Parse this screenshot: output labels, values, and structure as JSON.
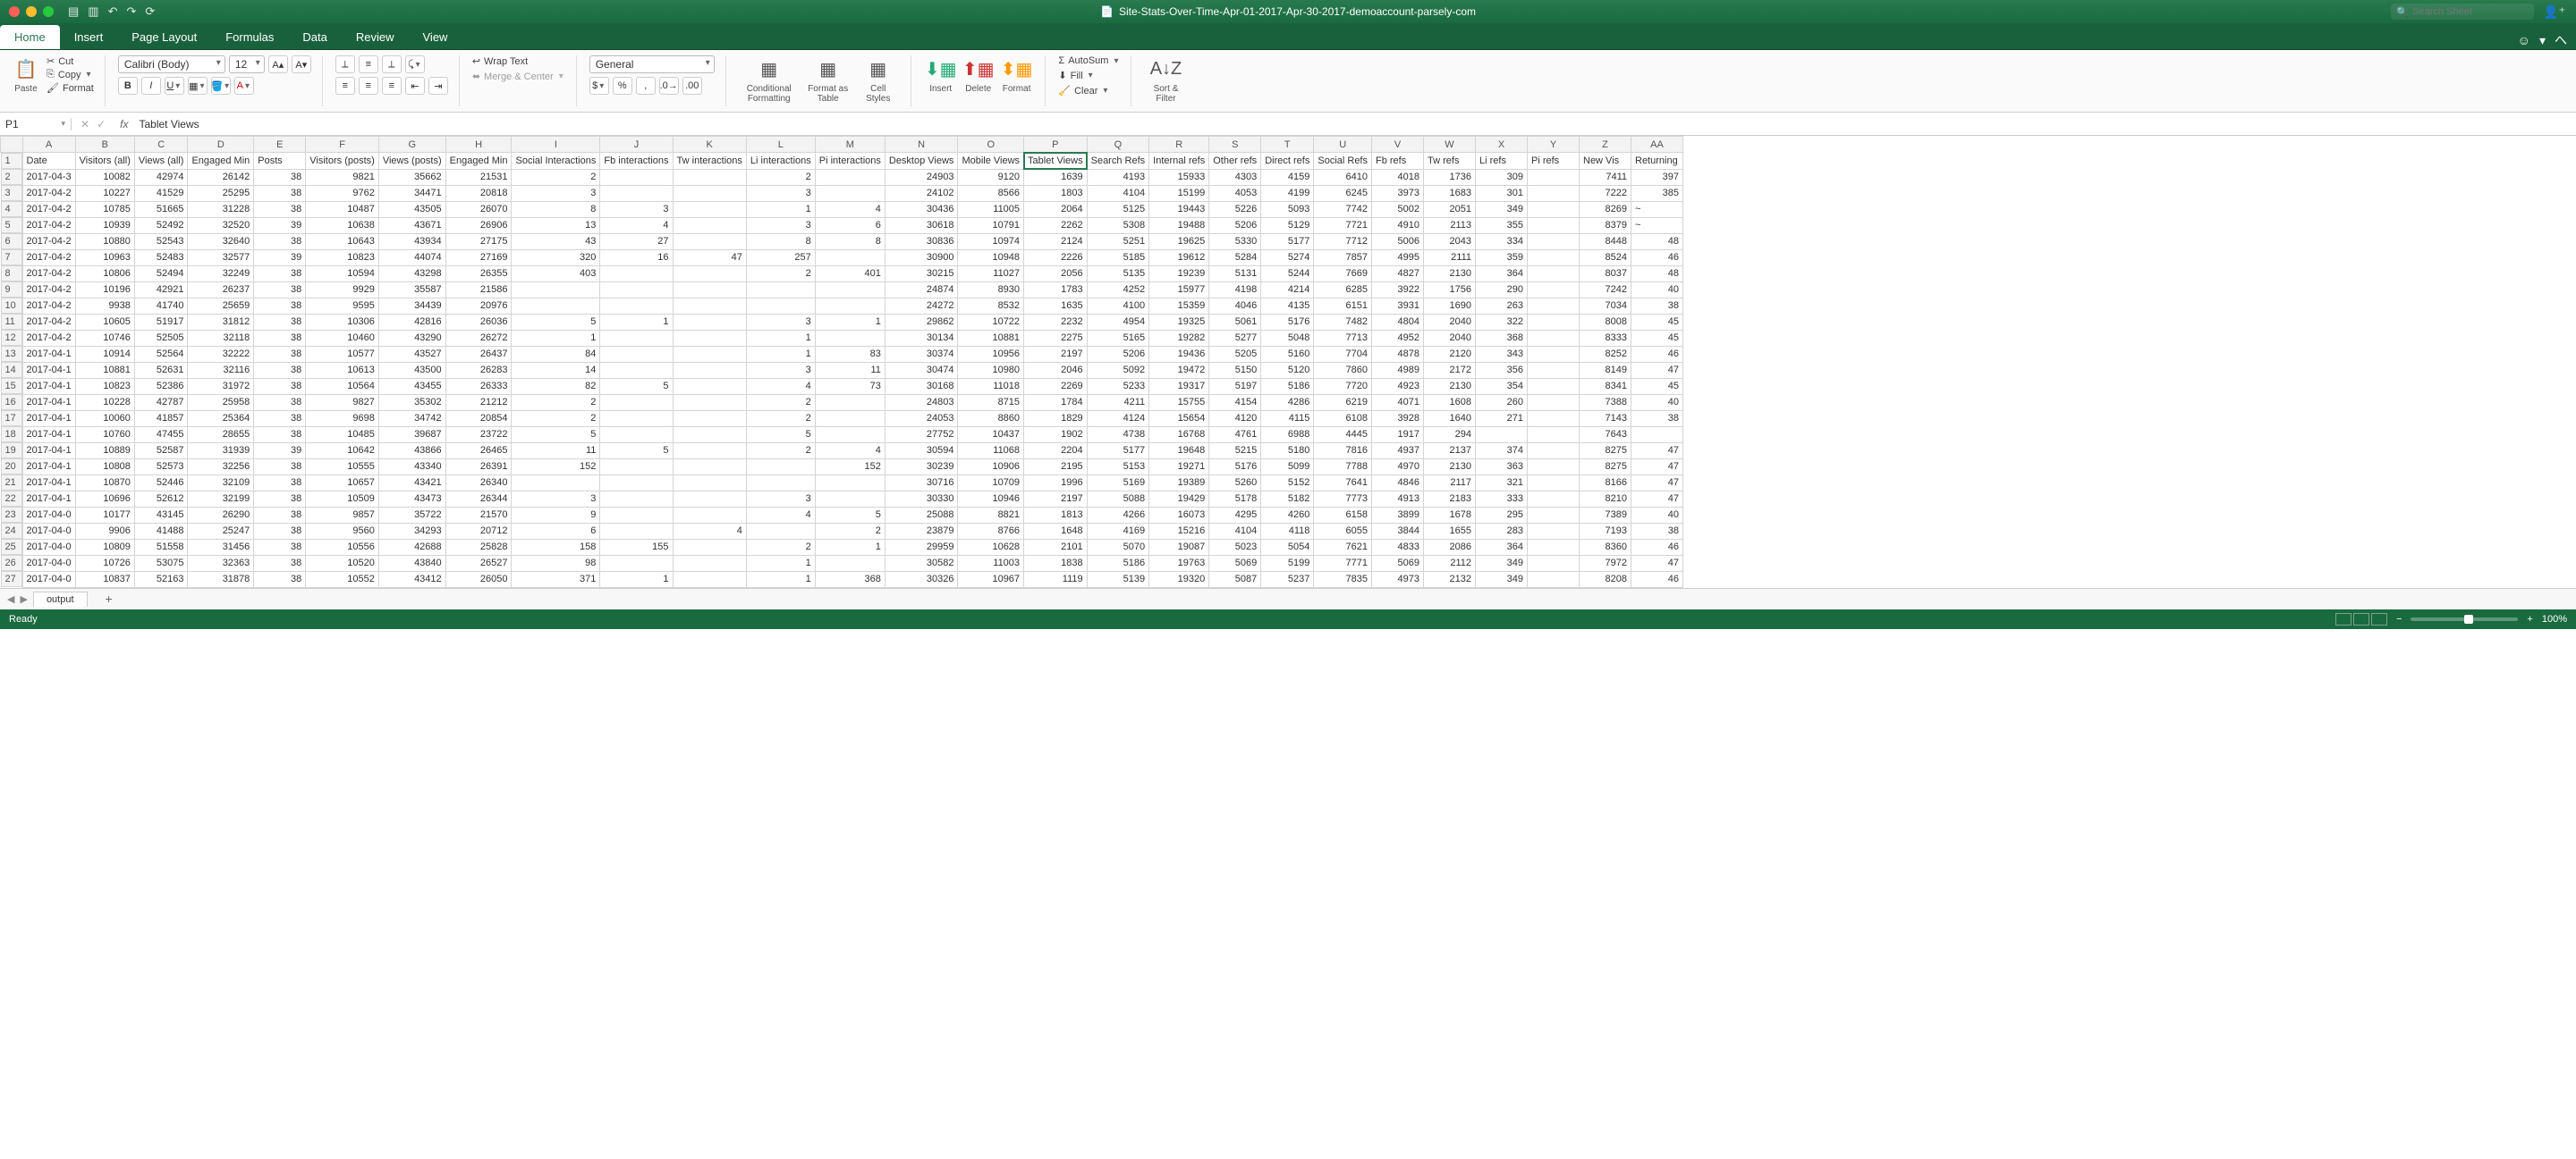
{
  "title": "Site-Stats-Over-Time-Apr-01-2017-Apr-30-2017-demoaccount-parsely-com",
  "search_placeholder": "Search Sheet",
  "tabs": [
    "Home",
    "Insert",
    "Page Layout",
    "Formulas",
    "Data",
    "Review",
    "View"
  ],
  "active_tab": "Home",
  "ribbon": {
    "paste": "Paste",
    "cut": "Cut",
    "copy": "Copy",
    "format": "Format",
    "font_name": "Calibri (Body)",
    "font_size": "12",
    "wrap": "Wrap Text",
    "merge": "Merge & Center",
    "number_format": "General",
    "cond_fmt": "Conditional Formatting",
    "as_table": "Format as Table",
    "cell_styles": "Cell Styles",
    "insert": "Insert",
    "delete": "Delete",
    "format_btn": "Format",
    "autosum": "AutoSum",
    "fill": "Fill",
    "clear": "Clear",
    "sort": "Sort & Filter"
  },
  "name_box": "P1",
  "formula": "Tablet Views",
  "columns": [
    "A",
    "B",
    "C",
    "D",
    "E",
    "F",
    "G",
    "H",
    "I",
    "J",
    "K",
    "L",
    "M",
    "N",
    "O",
    "P",
    "Q",
    "R",
    "S",
    "T",
    "U",
    "V",
    "W",
    "X",
    "Y",
    "Z",
    "AA"
  ],
  "selected_col": "P",
  "headers": [
    "Date",
    "Visitors (all)",
    "Views (all)",
    "Engaged Min",
    "Posts",
    "Visitors (posts)",
    "Views (posts)",
    "Engaged Min",
    "Social Interactions",
    "Fb interactions",
    "Tw interactions",
    "Li interactions",
    "Pi interactions",
    "Desktop Views",
    "Mobile Views",
    "Tablet Views",
    "Search Refs",
    "Internal refs",
    "Other refs",
    "Direct refs",
    "Social Refs",
    "Fb refs",
    "Tw refs",
    "Li refs",
    "Pi refs",
    "New Vis",
    "Returning"
  ],
  "rows": [
    [
      "2017-04-3",
      10082,
      42974,
      26142,
      38,
      9821,
      35662,
      21531,
      2,
      "",
      "",
      2,
      "",
      24903,
      9120,
      1639,
      4193,
      15933,
      4303,
      4159,
      6410,
      4018,
      1736,
      309,
      "",
      7411,
      397
    ],
    [
      "2017-04-2",
      10227,
      41529,
      25295,
      38,
      9762,
      34471,
      20818,
      3,
      "",
      "",
      3,
      "",
      24102,
      8566,
      1803,
      4104,
      15199,
      4053,
      4199,
      6245,
      3973,
      1683,
      301,
      "",
      7222,
      385
    ],
    [
      "2017-04-2",
      10785,
      51665,
      31228,
      38,
      10487,
      43505,
      26070,
      8,
      3,
      "",
      1,
      4,
      30436,
      11005,
      2064,
      5125,
      19443,
      5226,
      5093,
      7742,
      5002,
      2051,
      349,
      "",
      8269,
      "~"
    ],
    [
      "2017-04-2",
      10939,
      52492,
      32520,
      39,
      10638,
      43671,
      26906,
      13,
      4,
      "",
      3,
      6,
      30618,
      10791,
      2262,
      5308,
      19488,
      5206,
      5129,
      7721,
      4910,
      2113,
      355,
      "",
      8379,
      "~"
    ],
    [
      "2017-04-2",
      10880,
      52543,
      32640,
      38,
      10643,
      43934,
      27175,
      43,
      27,
      "",
      8,
      8,
      30836,
      10974,
      2124,
      5251,
      19625,
      5330,
      5177,
      7712,
      5006,
      2043,
      334,
      "",
      8448,
      48
    ],
    [
      "2017-04-2",
      10963,
      52483,
      32577,
      39,
      10823,
      44074,
      27169,
      320,
      16,
      47,
      257,
      "",
      30900,
      10948,
      2226,
      5185,
      19612,
      5284,
      5274,
      7857,
      4995,
      2111,
      359,
      "",
      8524,
      46
    ],
    [
      "2017-04-2",
      10806,
      52494,
      32249,
      38,
      10594,
      43298,
      26355,
      403,
      "",
      "",
      2,
      401,
      30215,
      11027,
      2056,
      5135,
      19239,
      5131,
      5244,
      7669,
      4827,
      2130,
      364,
      "",
      8037,
      48
    ],
    [
      "2017-04-2",
      10196,
      42921,
      26237,
      38,
      9929,
      35587,
      21586,
      "",
      "",
      "",
      "",
      "",
      24874,
      8930,
      1783,
      4252,
      15977,
      4198,
      4214,
      6285,
      3922,
      1756,
      290,
      "",
      7242,
      40
    ],
    [
      "2017-04-2",
      9938,
      41740,
      25659,
      38,
      9595,
      34439,
      20976,
      "",
      "",
      "",
      "",
      "",
      24272,
      8532,
      1635,
      4100,
      15359,
      4046,
      4135,
      6151,
      3931,
      1690,
      263,
      "",
      7034,
      38
    ],
    [
      "2017-04-2",
      10605,
      51917,
      31812,
      38,
      10306,
      42816,
      26036,
      5,
      1,
      "",
      3,
      1,
      29862,
      10722,
      2232,
      4954,
      19325,
      5061,
      5176,
      7482,
      4804,
      2040,
      322,
      "",
      8008,
      45
    ],
    [
      "2017-04-2",
      10746,
      52505,
      32118,
      38,
      10460,
      43290,
      26272,
      1,
      "",
      "",
      1,
      "",
      30134,
      10881,
      2275,
      5165,
      19282,
      5277,
      5048,
      7713,
      4952,
      2040,
      368,
      "",
      8333,
      45
    ],
    [
      "2017-04-1",
      10914,
      52564,
      32222,
      38,
      10577,
      43527,
      26437,
      84,
      "",
      "",
      1,
      83,
      30374,
      10956,
      2197,
      5206,
      19436,
      5205,
      5160,
      7704,
      4878,
      2120,
      343,
      "",
      8252,
      46
    ],
    [
      "2017-04-1",
      10881,
      52631,
      32116,
      38,
      10613,
      43500,
      26283,
      14,
      "",
      "",
      3,
      11,
      30474,
      10980,
      2046,
      5092,
      19472,
      5150,
      5120,
      7860,
      4989,
      2172,
      356,
      "",
      8149,
      47
    ],
    [
      "2017-04-1",
      10823,
      52386,
      31972,
      38,
      10564,
      43455,
      26333,
      82,
      5,
      "",
      4,
      73,
      30168,
      11018,
      2269,
      5233,
      19317,
      5197,
      5186,
      7720,
      4923,
      2130,
      354,
      "",
      8341,
      45
    ],
    [
      "2017-04-1",
      10228,
      42787,
      25958,
      38,
      9827,
      35302,
      21212,
      2,
      "",
      "",
      2,
      "",
      24803,
      8715,
      1784,
      4211,
      15755,
      4154,
      4286,
      6219,
      4071,
      1608,
      260,
      "",
      7388,
      40
    ],
    [
      "2017-04-1",
      10060,
      41857,
      25364,
      38,
      9698,
      34742,
      20854,
      2,
      "",
      "",
      2,
      "",
      24053,
      8860,
      1829,
      4124,
      15654,
      4120,
      4115,
      6108,
      3928,
      1640,
      271,
      "",
      7143,
      38
    ],
    [
      "2017-04-1",
      10760,
      47455,
      28655,
      38,
      10485,
      39687,
      23722,
      5,
      "",
      "",
      5,
      "",
      27752,
      10437,
      1902,
      4738,
      16768,
      4761,
      6988,
      4445,
      1917,
      294,
      "",
      "",
      7643,
      ""
    ],
    [
      "2017-04-1",
      10889,
      52587,
      31939,
      39,
      10642,
      43866,
      26465,
      11,
      5,
      "",
      2,
      4,
      30594,
      11068,
      2204,
      5177,
      19648,
      5215,
      5180,
      7816,
      4937,
      2137,
      374,
      "",
      8275,
      47
    ],
    [
      "2017-04-1",
      10808,
      52573,
      32256,
      38,
      10555,
      43340,
      26391,
      152,
      "",
      "",
      "",
      152,
      30239,
      10906,
      2195,
      5153,
      19271,
      5176,
      5099,
      7788,
      4970,
      2130,
      363,
      "",
      8275,
      47
    ],
    [
      "2017-04-1",
      10870,
      52446,
      32109,
      38,
      10657,
      43421,
      26340,
      "",
      "",
      "",
      "",
      "",
      30716,
      10709,
      1996,
      5169,
      19389,
      5260,
      5152,
      7641,
      4846,
      2117,
      321,
      "",
      8166,
      47
    ],
    [
      "2017-04-1",
      10696,
      52612,
      32199,
      38,
      10509,
      43473,
      26344,
      3,
      "",
      "",
      3,
      "",
      30330,
      10946,
      2197,
      5088,
      19429,
      5178,
      5182,
      7773,
      4913,
      2183,
      333,
      "",
      8210,
      47
    ],
    [
      "2017-04-0",
      10177,
      43145,
      26290,
      38,
      9857,
      35722,
      21570,
      9,
      "",
      "",
      4,
      5,
      25088,
      8821,
      1813,
      4266,
      16073,
      4295,
      4260,
      6158,
      3899,
      1678,
      295,
      "",
      7389,
      40
    ],
    [
      "2017-04-0",
      9906,
      41488,
      25247,
      38,
      9560,
      34293,
      20712,
      6,
      "",
      4,
      "",
      2,
      23879,
      8766,
      1648,
      4169,
      15216,
      4104,
      4118,
      6055,
      3844,
      1655,
      283,
      "",
      7193,
      38
    ],
    [
      "2017-04-0",
      10809,
      51558,
      31456,
      38,
      10556,
      42688,
      25828,
      158,
      155,
      "",
      2,
      1,
      29959,
      10628,
      2101,
      5070,
      19087,
      5023,
      5054,
      7621,
      4833,
      2086,
      364,
      "",
      8360,
      46
    ],
    [
      "2017-04-0",
      10726,
      53075,
      32363,
      38,
      10520,
      43840,
      26527,
      98,
      "",
      "",
      1,
      "",
      30582,
      11003,
      1838,
      5186,
      19763,
      5069,
      5199,
      7771,
      5069,
      2112,
      349,
      "",
      7972,
      47
    ],
    [
      "2017-04-0",
      10837,
      52163,
      31878,
      38,
      10552,
      43412,
      26050,
      371,
      1,
      "",
      1,
      368,
      30326,
      10967,
      1119,
      5139,
      19320,
      5087,
      5237,
      7835,
      4973,
      2132,
      349,
      "",
      8208,
      46
    ]
  ],
  "sheet_name": "output",
  "status": "Ready",
  "zoom": "100%"
}
